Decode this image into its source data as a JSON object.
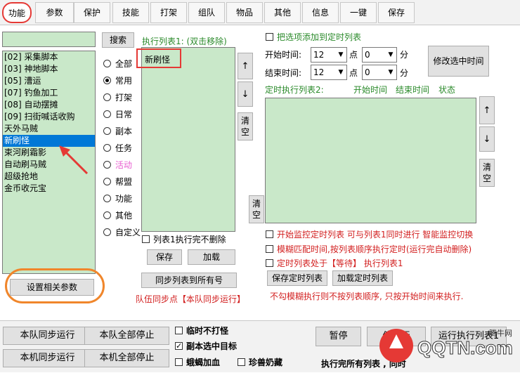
{
  "tabs": [
    "功能",
    "参数",
    "保护",
    "技能",
    "打架",
    "组队",
    "物品",
    "其他",
    "信息",
    "一键",
    "保存"
  ],
  "left": {
    "search_value": "",
    "search_button": "搜索",
    "list": [
      "[02] 采集脚本",
      "[03] 神地脚本",
      "[05] 漕运",
      "[07] 钓鱼加工",
      "[08] 自动摆摊",
      "[09] 扫街喊话收购",
      "天外马贼",
      "新刷怪",
      "束河刷霜影",
      "自动刷马贼",
      "超级抢地",
      "金币收元宝"
    ],
    "selected_index": 7,
    "settings_button": "设置相关参数"
  },
  "radios": [
    {
      "label": "全部",
      "checked": false
    },
    {
      "label": "常用",
      "checked": true
    },
    {
      "label": "打架",
      "checked": false
    },
    {
      "label": "日常",
      "checked": false
    },
    {
      "label": "副本",
      "checked": false
    },
    {
      "label": "任务",
      "checked": false
    },
    {
      "label": "活动",
      "checked": false
    },
    {
      "label": "帮盟",
      "checked": false
    },
    {
      "label": "功能",
      "checked": false
    },
    {
      "label": "其他",
      "checked": false
    },
    {
      "label": "自定义",
      "checked": false
    }
  ],
  "exec_list": {
    "title": "执行列表1: (双击移除)",
    "items": [
      "新刷怪"
    ],
    "up": "↑",
    "down": "↓",
    "clear": "清空",
    "no_delete_label": "列表1执行完不删除",
    "save": "保存",
    "load": "加载",
    "sync_button": "同步列表到所有号",
    "sync_point": "队伍同步点【本队同步运行】"
  },
  "timer": {
    "add_label": "把选项添加到定时列表",
    "start_label": "开始时间:",
    "end_label": "结束时间:",
    "start_hour": "12",
    "start_min": "0",
    "end_hour": "12",
    "end_min": "0",
    "point": "点",
    "minute": "分",
    "modify_button": "修改选中时间",
    "list_title": "定时执行列表2:",
    "col_start": "开始时间",
    "col_end": "结束时间",
    "col_status": "状态",
    "up": "↑",
    "down": "↓",
    "clear": "清空",
    "clear_left": "清空",
    "opt1": "开始监控定时列表 可与列表1同时进行 智能监控切换",
    "opt2": "模糊匹配时间,按列表顺序执行定时(运行完自动删除)",
    "opt3": "定时列表处于【等待】 执行列表1",
    "save_btn": "保存定时列表",
    "load_btn": "加载定时列表",
    "note": "不勾模糊执行则不按列表顺序, 只按开始时间来执行."
  },
  "bottom": {
    "team_sync_run": "本队同步运行",
    "team_stop_all": "本队全部停止",
    "local_sync_run": "本机同步运行",
    "local_stop_all": "本机全部停止",
    "chk1": "临时不打怪",
    "chk2": "副本选中目标",
    "chk3": "蛾蝎加血",
    "chk4": "珍兽奶藏",
    "pause": "暂停",
    "mid_btn": "停运行",
    "run_list": "运行执行列表1",
    "status_text": "执行完所有列表 ,  同时"
  },
  "watermark": {
    "text": "QQTN.com",
    "sub": "腾牛网"
  }
}
